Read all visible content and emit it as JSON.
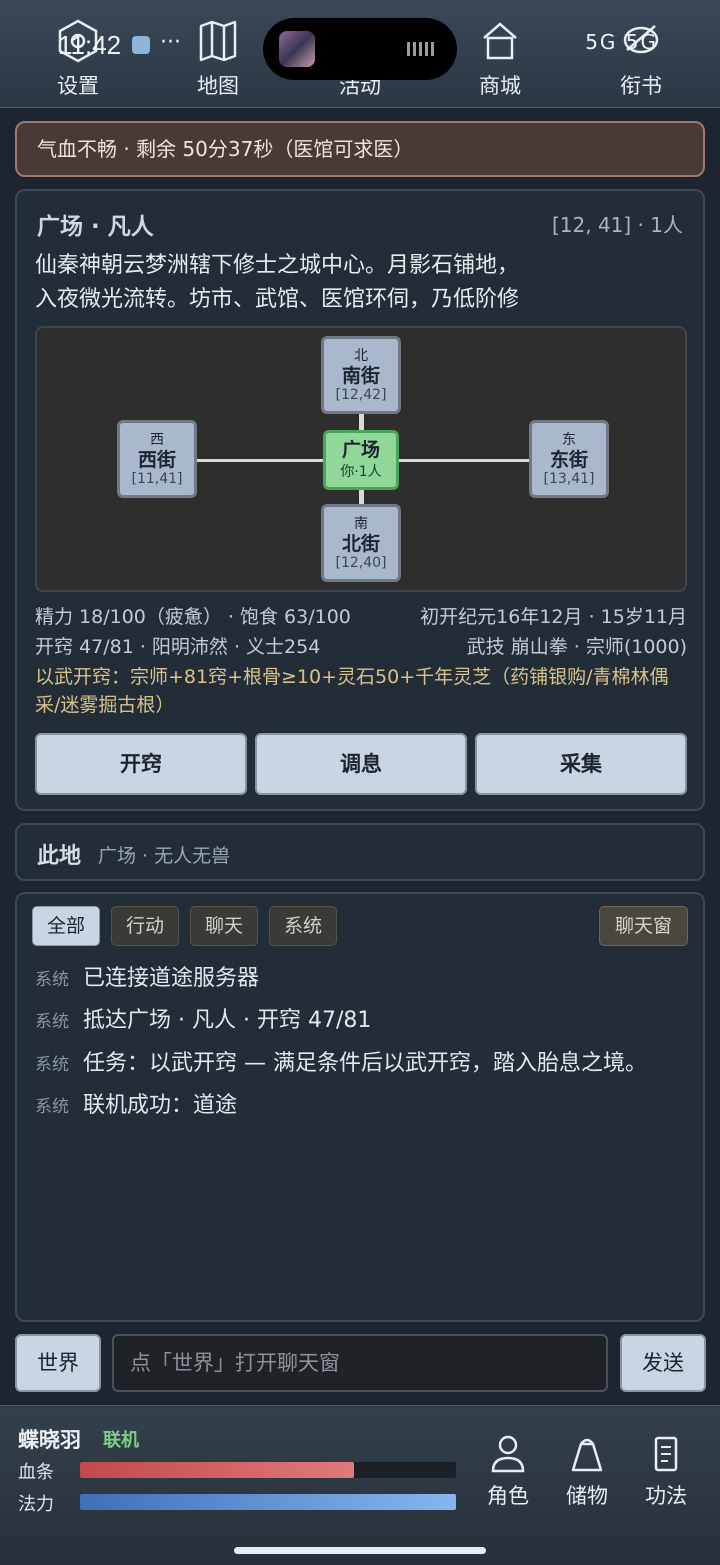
{
  "status_bar": {
    "time": "11:42",
    "dots": "···",
    "network": "5G  5G"
  },
  "top_nav": [
    {
      "label": "设置",
      "icon": "settings-hex-icon"
    },
    {
      "label": "地图",
      "icon": "map-icon"
    },
    {
      "label": "活动",
      "icon": "activity-icon"
    },
    {
      "label": "商城",
      "icon": "shop-icon"
    },
    {
      "label": "衔书",
      "icon": "message-icon"
    }
  ],
  "alert": {
    "text": "气血不畅 · 剩余 50分37秒（医馆可求医）"
  },
  "location": {
    "title": "广场 · 凡人",
    "meta": "[12, 41] · 1人",
    "desc_line1": "仙秦神朝云梦洲辖下修士之城中心。月影石铺地，",
    "desc_line2": "入夜微光流转。坊市、武馆、医馆环伺，乃低阶修",
    "map": {
      "north": {
        "dir": "北",
        "name": "南街",
        "coord": "[12,42]"
      },
      "west": {
        "dir": "西",
        "name": "西街",
        "coord": "[11,41]"
      },
      "center": {
        "name": "广场",
        "sub": "你·1人"
      },
      "east": {
        "dir": "东",
        "name": "东街",
        "coord": "[13,41]"
      },
      "south": {
        "dir": "南",
        "name": "北街",
        "coord": "[12,40]"
      }
    },
    "stats": {
      "row1_left": "精力 18/100（疲惫） · 饱食 63/100",
      "row1_right": "初开纪元16年12月 · 15岁11月",
      "row2_left": "开窍 47/81 · 阳明沛然 · 义士254",
      "row2_right": "武技 崩山拳 · 宗师(1000)"
    },
    "quest_line1": "以武开窍：宗师+81窍+根骨≥10+灵石50+千年灵芝（药铺银购/青棉林偶",
    "quest_line2": "采/迷雾掘古根）",
    "buttons": [
      "开窍",
      "调息",
      "采集"
    ]
  },
  "here": {
    "label": "此地",
    "text": "广场 · 无人无兽"
  },
  "chat": {
    "tabs": [
      "全部",
      "行动",
      "聊天",
      "系统"
    ],
    "window_button": "聊天窗",
    "messages": [
      {
        "tag": "系统",
        "text": "已连接道途服务器"
      },
      {
        "tag": "系统",
        "text": "抵达广场 · 凡人 · 开窍 47/81"
      },
      {
        "tag": "系统",
        "text": "任务：以武开窍 — 满足条件后以武开窍，踏入胎息之境。"
      },
      {
        "tag": "系统",
        "text": "联机成功：道途"
      }
    ]
  },
  "input_row": {
    "world_button": "世界",
    "placeholder": "点「世界」打开聊天窗",
    "send_button": "发送"
  },
  "player": {
    "name": "蝶晓羽",
    "status": "联机",
    "hp_label": "血条",
    "mp_label": "法力",
    "hp_fraction": 0.73,
    "mp_fraction": 1.0
  },
  "bottom_nav": [
    {
      "label": "角色",
      "icon": "person-icon"
    },
    {
      "label": "储物",
      "icon": "bag-icon"
    },
    {
      "label": "功法",
      "icon": "scroll-icon"
    }
  ],
  "colors": {
    "hp": "#c24a4a",
    "mp": "#3f6fb8",
    "online": "#7fcf87",
    "current_node": "#8fd89a"
  }
}
